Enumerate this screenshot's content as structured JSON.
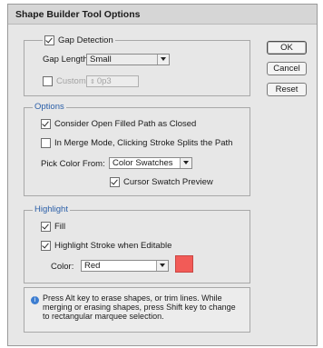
{
  "dialog": {
    "title": "Shape Builder Tool Options"
  },
  "gap": {
    "checkbox_label": "Gap Detection",
    "length_label": "Gap Length:",
    "length_value": "Small",
    "custom_label": "Custom:",
    "custom_value": "0p3"
  },
  "buttons": {
    "ok": "OK",
    "cancel": "Cancel",
    "reset": "Reset"
  },
  "options": {
    "legend": "Options",
    "consider_label": "Consider Open Filled Path as Closed",
    "merge_label": "In Merge Mode, Clicking Stroke Splits the Path",
    "pick_label": "Pick Color From:",
    "pick_value": "Color Swatches",
    "cursor_label": "Cursor Swatch Preview"
  },
  "highlight": {
    "legend": "Highlight",
    "fill_label": "Fill",
    "stroke_label": "Highlight Stroke when Editable",
    "color_label": "Color:",
    "color_value": "Red",
    "swatch_color": "#f25b57"
  },
  "info": {
    "text": "Press Alt key to erase shapes, or trim lines. While merging or erasing shapes, press Shift key to change to rectangular marquee selection."
  },
  "colors": {
    "accent": "#2b5fa8"
  }
}
